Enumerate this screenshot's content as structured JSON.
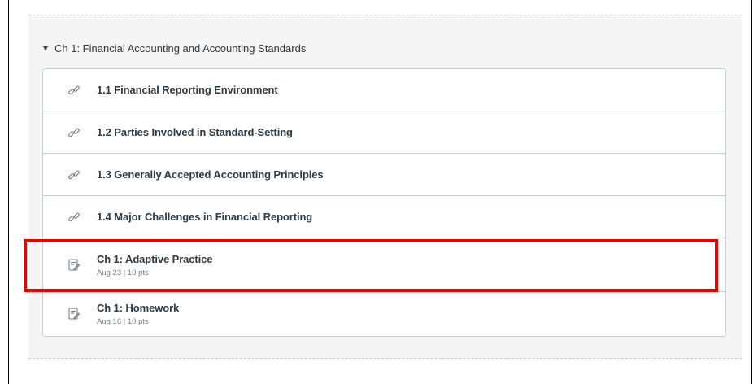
{
  "module": {
    "title": "Ch 1: Financial Accounting and Accounting Standards",
    "expanded": true
  },
  "items": [
    {
      "title": "1.1 Financial Reporting Environment",
      "icon": "link-icon",
      "meta": ""
    },
    {
      "title": "1.2 Parties Involved in Standard-Setting",
      "icon": "link-icon",
      "meta": ""
    },
    {
      "title": "1.3 Generally Accepted Accounting Principles",
      "icon": "link-icon",
      "meta": ""
    },
    {
      "title": "1.4 Major Challenges in Financial Reporting",
      "icon": "link-icon",
      "meta": ""
    },
    {
      "title": "Ch 1: Adaptive Practice",
      "icon": "assignment-icon",
      "meta": "Aug 23 | 10 pts",
      "highlighted": true
    },
    {
      "title": "Ch 1: Homework",
      "icon": "assignment-icon",
      "meta": "Aug 16 | 10 pts"
    }
  ],
  "colors": {
    "highlight": "#e10600",
    "text": "#2d3b45",
    "meta": "#73818c",
    "border": "#c7cdd1",
    "module_bg": "#f5f5f5"
  }
}
